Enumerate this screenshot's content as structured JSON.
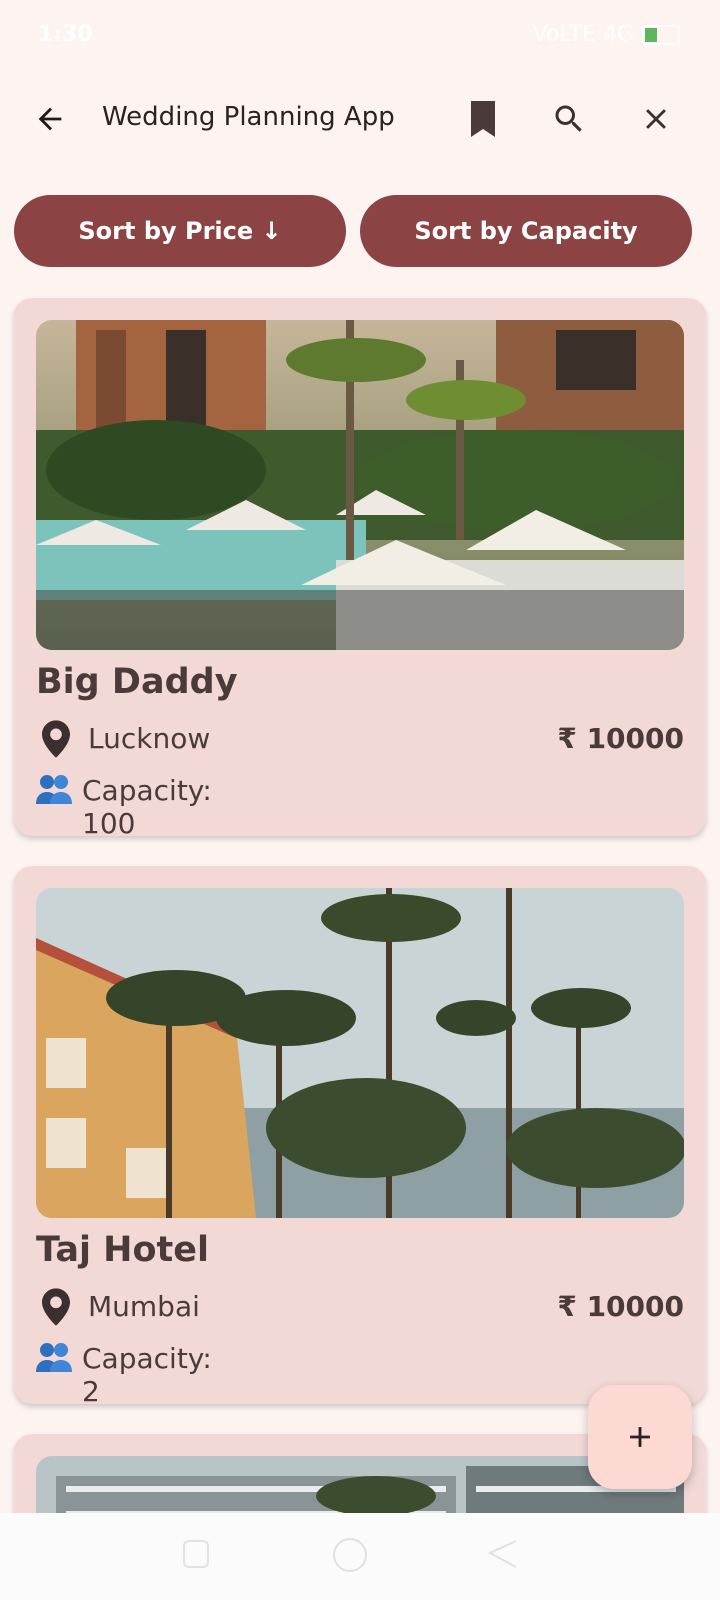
{
  "status": {
    "time": "1:30",
    "right_text": "VoLTE 4G",
    "battery_level_percent": 40
  },
  "app_bar": {
    "title": "Wedding Planning App",
    "back_icon": "arrow-left-icon",
    "bookmark_icon": "bookmark-icon",
    "search_icon": "search-icon",
    "close_icon": "close-icon"
  },
  "sort": {
    "price_label": "Sort by Price ↓",
    "capacity_label": "Sort by Capacity"
  },
  "venues": [
    {
      "name": "Big Daddy",
      "location": "Lucknow",
      "price": "₹ 10000",
      "capacity": "Capacity: 100"
    },
    {
      "name": "Taj Hotel",
      "location": "Mumbai",
      "price": "₹ 10000",
      "capacity": "Capacity: 2"
    }
  ],
  "fab": {
    "label": "+"
  },
  "colors": {
    "accent": "#8b4443",
    "card": "#f3d9d6",
    "background": "#fdf4f2",
    "fab": "#fdd9d4"
  }
}
